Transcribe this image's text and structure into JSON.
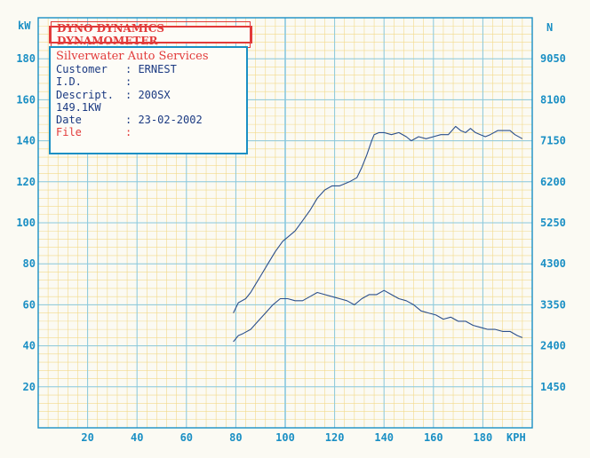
{
  "title": "DYNO DYNAMICS DYNAMOMETER",
  "info": {
    "company": "Silverwater Auto Services",
    "rows": [
      {
        "key": "Customer",
        "sep": ":",
        "value": "ERNEST"
      },
      {
        "key": "I.D.",
        "sep": ":",
        "value": ""
      },
      {
        "key": "Descript.",
        "sep": ":",
        "value": "200SX"
      },
      {
        "key": "149.1KW",
        "sep": "",
        "value": ""
      },
      {
        "key": "Date",
        "sep": ":",
        "value": "23-02-2002"
      },
      {
        "key": "File",
        "sep": ":",
        "value": ""
      }
    ]
  },
  "colors": {
    "grid_minor": "#f2d98a",
    "grid_major": "#88c8df",
    "axis_text": "#1a8fc4",
    "axis_line": "#1a8fc4",
    "curve": "#2b4f8c",
    "title_red": "#e23a3a",
    "box_blue": "#1a8fc4"
  },
  "chart_data": {
    "type": "line",
    "x_label": "KPH",
    "y_left_label": "kW",
    "y_right_label": "N",
    "x_ticks": [
      20,
      40,
      60,
      80,
      100,
      120,
      140,
      160,
      180
    ],
    "y_left_ticks": [
      20,
      40,
      60,
      80,
      100,
      120,
      140,
      160,
      180
    ],
    "y_right_ticks": [
      "1450",
      "2400",
      "3350",
      "4300",
      "5250",
      "6200",
      "7150",
      "8100",
      "9050"
    ],
    "xlim": [
      0,
      200
    ],
    "ylim_left": [
      0,
      200
    ],
    "grid": true,
    "series": [
      {
        "key": "power",
        "x": [
          79,
          81,
          84,
          86,
          88,
          90,
          93,
          96,
          99,
          101,
          104,
          107,
          110,
          113,
          116,
          119,
          122,
          124,
          126,
          129,
          131,
          133,
          135,
          136,
          138,
          140,
          143,
          146,
          149,
          151,
          154,
          157,
          160,
          163,
          166,
          169,
          171,
          173,
          175,
          177,
          179,
          181,
          183,
          186,
          189,
          191,
          193,
          196
        ],
        "y": [
          56,
          61,
          63,
          66,
          70,
          74,
          80,
          86,
          91,
          93,
          96,
          101,
          106,
          112,
          116,
          118,
          118,
          119,
          120,
          122,
          127,
          133,
          140,
          143,
          144,
          144,
          143,
          144,
          142,
          140,
          142,
          141,
          142,
          143,
          143,
          147,
          145,
          144,
          146,
          144,
          143,
          142,
          143,
          145,
          145,
          145,
          143,
          141
        ]
      },
      {
        "key": "force",
        "x": [
          79,
          81,
          83,
          86,
          89,
          92,
          95,
          98,
          101,
          104,
          107,
          110,
          113,
          116,
          119,
          122,
          125,
          128,
          131,
          134,
          137,
          140,
          143,
          146,
          149,
          152,
          155,
          158,
          161,
          164,
          167,
          170,
          173,
          176,
          179,
          182,
          185,
          188,
          191,
          194,
          196
        ],
        "y": [
          42,
          45,
          46,
          48,
          52,
          56,
          60,
          63,
          63,
          62,
          62,
          64,
          66,
          65,
          64,
          63,
          62,
          60,
          63,
          65,
          65,
          67,
          65,
          63,
          62,
          60,
          57,
          56,
          55,
          53,
          54,
          52,
          52,
          50,
          49,
          48,
          48,
          47,
          47,
          45,
          44
        ]
      }
    ]
  }
}
